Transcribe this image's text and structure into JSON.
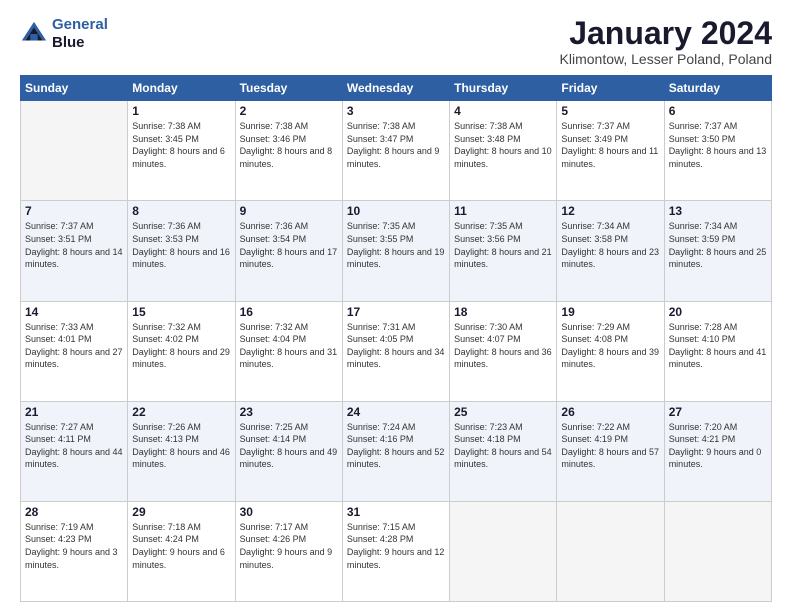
{
  "header": {
    "logo_line1": "General",
    "logo_line2": "Blue",
    "title": "January 2024",
    "subtitle": "Klimontow, Lesser Poland, Poland"
  },
  "days_of_week": [
    "Sunday",
    "Monday",
    "Tuesday",
    "Wednesday",
    "Thursday",
    "Friday",
    "Saturday"
  ],
  "weeks": [
    [
      {
        "day": "",
        "sunrise": "",
        "sunset": "",
        "daylight": ""
      },
      {
        "day": "1",
        "sunrise": "Sunrise: 7:38 AM",
        "sunset": "Sunset: 3:45 PM",
        "daylight": "Daylight: 8 hours and 6 minutes."
      },
      {
        "day": "2",
        "sunrise": "Sunrise: 7:38 AM",
        "sunset": "Sunset: 3:46 PM",
        "daylight": "Daylight: 8 hours and 8 minutes."
      },
      {
        "day": "3",
        "sunrise": "Sunrise: 7:38 AM",
        "sunset": "Sunset: 3:47 PM",
        "daylight": "Daylight: 8 hours and 9 minutes."
      },
      {
        "day": "4",
        "sunrise": "Sunrise: 7:38 AM",
        "sunset": "Sunset: 3:48 PM",
        "daylight": "Daylight: 8 hours and 10 minutes."
      },
      {
        "day": "5",
        "sunrise": "Sunrise: 7:37 AM",
        "sunset": "Sunset: 3:49 PM",
        "daylight": "Daylight: 8 hours and 11 minutes."
      },
      {
        "day": "6",
        "sunrise": "Sunrise: 7:37 AM",
        "sunset": "Sunset: 3:50 PM",
        "daylight": "Daylight: 8 hours and 13 minutes."
      }
    ],
    [
      {
        "day": "7",
        "sunrise": "Sunrise: 7:37 AM",
        "sunset": "Sunset: 3:51 PM",
        "daylight": "Daylight: 8 hours and 14 minutes."
      },
      {
        "day": "8",
        "sunrise": "Sunrise: 7:36 AM",
        "sunset": "Sunset: 3:53 PM",
        "daylight": "Daylight: 8 hours and 16 minutes."
      },
      {
        "day": "9",
        "sunrise": "Sunrise: 7:36 AM",
        "sunset": "Sunset: 3:54 PM",
        "daylight": "Daylight: 8 hours and 17 minutes."
      },
      {
        "day": "10",
        "sunrise": "Sunrise: 7:35 AM",
        "sunset": "Sunset: 3:55 PM",
        "daylight": "Daylight: 8 hours and 19 minutes."
      },
      {
        "day": "11",
        "sunrise": "Sunrise: 7:35 AM",
        "sunset": "Sunset: 3:56 PM",
        "daylight": "Daylight: 8 hours and 21 minutes."
      },
      {
        "day": "12",
        "sunrise": "Sunrise: 7:34 AM",
        "sunset": "Sunset: 3:58 PM",
        "daylight": "Daylight: 8 hours and 23 minutes."
      },
      {
        "day": "13",
        "sunrise": "Sunrise: 7:34 AM",
        "sunset": "Sunset: 3:59 PM",
        "daylight": "Daylight: 8 hours and 25 minutes."
      }
    ],
    [
      {
        "day": "14",
        "sunrise": "Sunrise: 7:33 AM",
        "sunset": "Sunset: 4:01 PM",
        "daylight": "Daylight: 8 hours and 27 minutes."
      },
      {
        "day": "15",
        "sunrise": "Sunrise: 7:32 AM",
        "sunset": "Sunset: 4:02 PM",
        "daylight": "Daylight: 8 hours and 29 minutes."
      },
      {
        "day": "16",
        "sunrise": "Sunrise: 7:32 AM",
        "sunset": "Sunset: 4:04 PM",
        "daylight": "Daylight: 8 hours and 31 minutes."
      },
      {
        "day": "17",
        "sunrise": "Sunrise: 7:31 AM",
        "sunset": "Sunset: 4:05 PM",
        "daylight": "Daylight: 8 hours and 34 minutes."
      },
      {
        "day": "18",
        "sunrise": "Sunrise: 7:30 AM",
        "sunset": "Sunset: 4:07 PM",
        "daylight": "Daylight: 8 hours and 36 minutes."
      },
      {
        "day": "19",
        "sunrise": "Sunrise: 7:29 AM",
        "sunset": "Sunset: 4:08 PM",
        "daylight": "Daylight: 8 hours and 39 minutes."
      },
      {
        "day": "20",
        "sunrise": "Sunrise: 7:28 AM",
        "sunset": "Sunset: 4:10 PM",
        "daylight": "Daylight: 8 hours and 41 minutes."
      }
    ],
    [
      {
        "day": "21",
        "sunrise": "Sunrise: 7:27 AM",
        "sunset": "Sunset: 4:11 PM",
        "daylight": "Daylight: 8 hours and 44 minutes."
      },
      {
        "day": "22",
        "sunrise": "Sunrise: 7:26 AM",
        "sunset": "Sunset: 4:13 PM",
        "daylight": "Daylight: 8 hours and 46 minutes."
      },
      {
        "day": "23",
        "sunrise": "Sunrise: 7:25 AM",
        "sunset": "Sunset: 4:14 PM",
        "daylight": "Daylight: 8 hours and 49 minutes."
      },
      {
        "day": "24",
        "sunrise": "Sunrise: 7:24 AM",
        "sunset": "Sunset: 4:16 PM",
        "daylight": "Daylight: 8 hours and 52 minutes."
      },
      {
        "day": "25",
        "sunrise": "Sunrise: 7:23 AM",
        "sunset": "Sunset: 4:18 PM",
        "daylight": "Daylight: 8 hours and 54 minutes."
      },
      {
        "day": "26",
        "sunrise": "Sunrise: 7:22 AM",
        "sunset": "Sunset: 4:19 PM",
        "daylight": "Daylight: 8 hours and 57 minutes."
      },
      {
        "day": "27",
        "sunrise": "Sunrise: 7:20 AM",
        "sunset": "Sunset: 4:21 PM",
        "daylight": "Daylight: 9 hours and 0 minutes."
      }
    ],
    [
      {
        "day": "28",
        "sunrise": "Sunrise: 7:19 AM",
        "sunset": "Sunset: 4:23 PM",
        "daylight": "Daylight: 9 hours and 3 minutes."
      },
      {
        "day": "29",
        "sunrise": "Sunrise: 7:18 AM",
        "sunset": "Sunset: 4:24 PM",
        "daylight": "Daylight: 9 hours and 6 minutes."
      },
      {
        "day": "30",
        "sunrise": "Sunrise: 7:17 AM",
        "sunset": "Sunset: 4:26 PM",
        "daylight": "Daylight: 9 hours and 9 minutes."
      },
      {
        "day": "31",
        "sunrise": "Sunrise: 7:15 AM",
        "sunset": "Sunset: 4:28 PM",
        "daylight": "Daylight: 9 hours and 12 minutes."
      },
      {
        "day": "",
        "sunrise": "",
        "sunset": "",
        "daylight": ""
      },
      {
        "day": "",
        "sunrise": "",
        "sunset": "",
        "daylight": ""
      },
      {
        "day": "",
        "sunrise": "",
        "sunset": "",
        "daylight": ""
      }
    ]
  ]
}
